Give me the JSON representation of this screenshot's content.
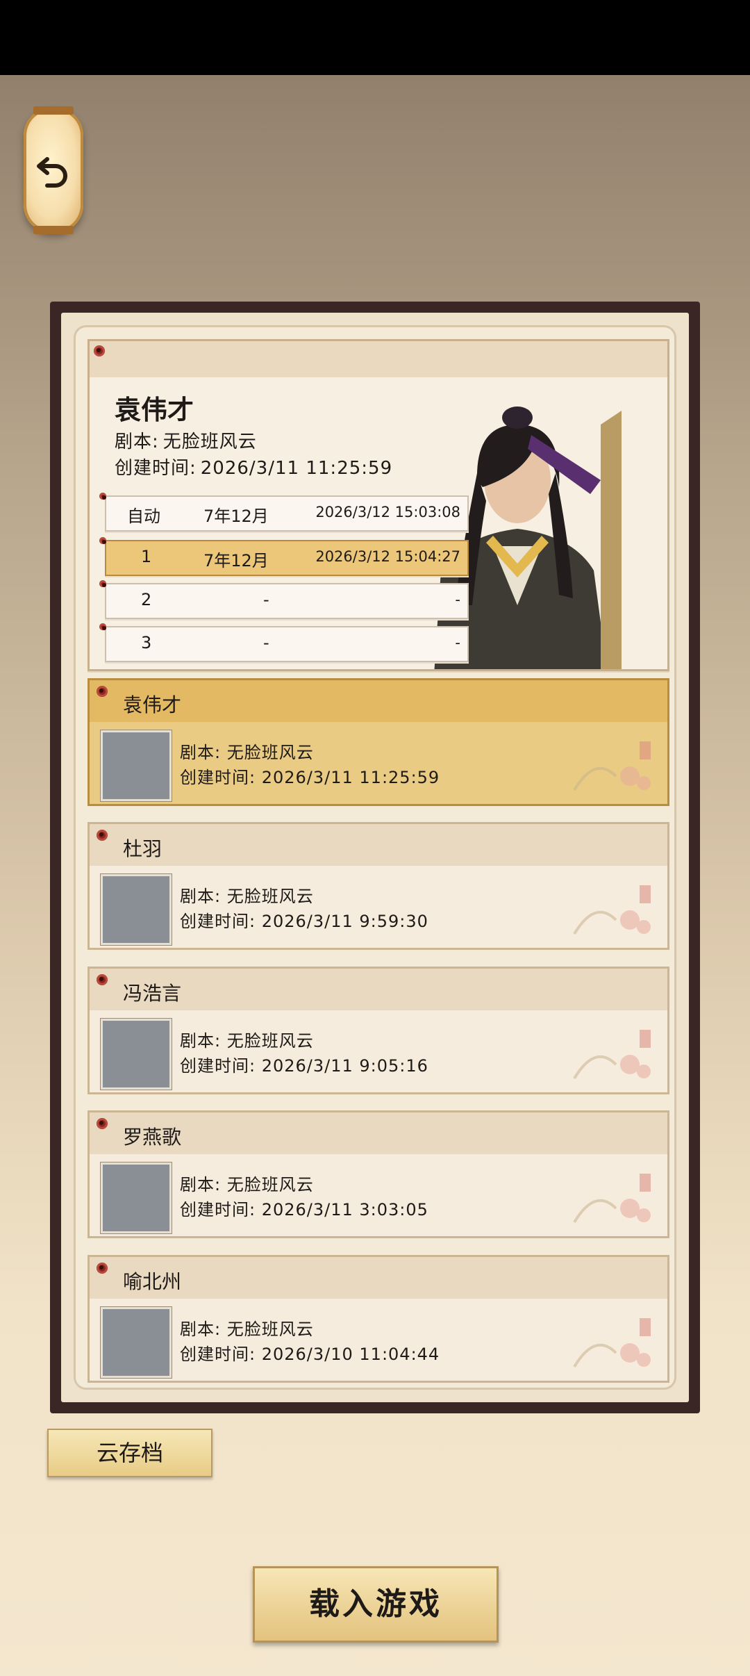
{
  "nav": {
    "back_icon": "undo-arrow-icon"
  },
  "selected": {
    "name": "袁伟才",
    "script_label": "剧本:",
    "script": "无脸班风云",
    "created_label": "创建时间:",
    "created": "2026/3/11 11:25:59",
    "slots": [
      {
        "label": "自动",
        "game_time": "7年12月",
        "saved": "2026/3/12 15:03:08"
      },
      {
        "label": "1",
        "game_time": "7年12月",
        "saved": "2026/3/12 15:04:27"
      },
      {
        "label": "2",
        "game_time": "-",
        "saved": "-"
      },
      {
        "label": "3",
        "game_time": "-",
        "saved": "-"
      }
    ]
  },
  "saves": [
    {
      "name": "袁伟才",
      "script": "剧本: 无脸班风云",
      "created": "创建时间: 2026/3/11 11:25:59"
    },
    {
      "name": "杜羽",
      "script": "剧本: 无脸班风云",
      "created": "创建时间: 2026/3/11 9:59:30"
    },
    {
      "name": "冯浩言",
      "script": "剧本: 无脸班风云",
      "created": "创建时间: 2026/3/11 9:05:16"
    },
    {
      "name": "罗燕歌",
      "script": "剧本: 无脸班风云",
      "created": "创建时间: 2026/3/11 3:03:05"
    },
    {
      "name": "喻北州",
      "script": "剧本: 无脸班风云",
      "created": "创建时间: 2026/3/10 11:04:44"
    }
  ],
  "buttons": {
    "cloud": "云存档",
    "load": "载入游戏"
  },
  "colors": {
    "accent": "#e3b964",
    "frame": "#3a2624",
    "paper": "#f4ead8"
  }
}
